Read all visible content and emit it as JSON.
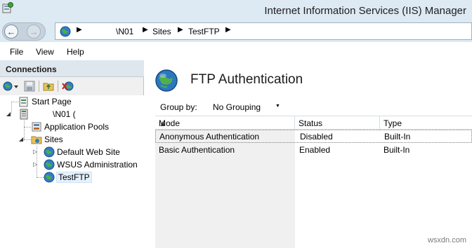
{
  "window": {
    "title": "Internet Information Services (IIS) Manager"
  },
  "address_bar": {
    "segments": [
      "\\N01",
      "Sites",
      "TestFTP"
    ]
  },
  "menu": {
    "file": "File",
    "view": "View",
    "help": "Help"
  },
  "connections": {
    "title": "Connections",
    "tree": {
      "start_page": "Start Page",
      "server": "\\N01 (",
      "app_pools": "Application Pools",
      "sites": "Sites",
      "default_site": "Default Web Site",
      "wsus": "WSUS Administration",
      "testftp": "TestFTP"
    }
  },
  "feature": {
    "title": "FTP Authentication",
    "group_by_label": "Group by:",
    "group_by_value": "No Grouping"
  },
  "grid": {
    "columns": [
      "Mode",
      "Status",
      "Type"
    ],
    "rows": [
      {
        "mode": "Anonymous Authentication",
        "status": "Disabled",
        "type": "Built-In"
      },
      {
        "mode": "Basic Authentication",
        "status": "Enabled",
        "type": "Built-In"
      }
    ]
  },
  "watermark": "wsxdn.com",
  "colors": {
    "title_bar": "#dde9f3",
    "pane_header": "#dfe7ee",
    "selection": "#e5f1fb"
  }
}
